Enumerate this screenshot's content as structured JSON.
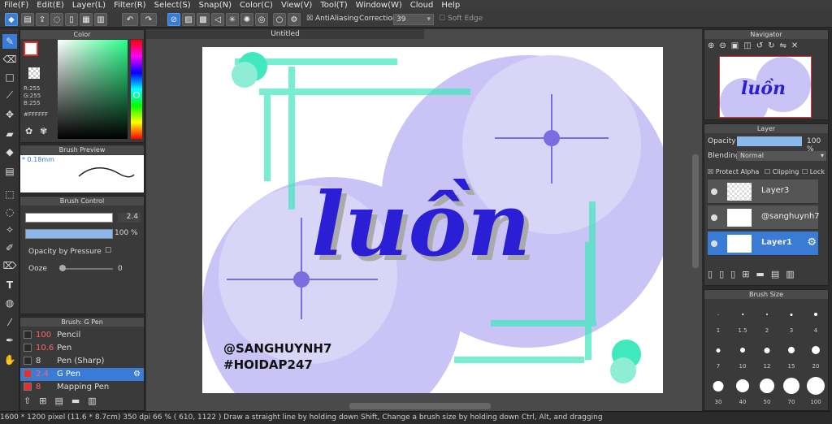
{
  "menu": [
    "File(F)",
    "Edit(E)",
    "Layer(L)",
    "Filter(R)",
    "Select(S)",
    "Snap(N)",
    "Color(C)",
    "View(V)",
    "Tool(T)",
    "Window(W)",
    "Cloud",
    "Help"
  ],
  "toolbar": {
    "antialiasing": "AntiAliasing",
    "correction_label": "Correction",
    "correction_value": "39",
    "soft_edge": "Soft Edge"
  },
  "color_panel": {
    "title": "Color",
    "r": "R:255",
    "g": "G:255",
    "b": "B:255",
    "hex": "#FFFFFF"
  },
  "brush_preview": {
    "title": "Brush Preview",
    "size": "0.18mm"
  },
  "brush_control": {
    "title": "Brush Control",
    "size": "2.4",
    "opacity": "100 %",
    "opacity_by_pressure": "Opacity by Pressure",
    "ooze": "Ooze",
    "ooze_value": "0"
  },
  "brush_list": {
    "title": "Brush: G Pen",
    "items": [
      {
        "size": "100",
        "name": "Pencil",
        "color": "#2a2a2a"
      },
      {
        "size": "10.6",
        "name": "Pen",
        "color": "#2a2a2a"
      },
      {
        "size": "8",
        "name": "Pen (Sharp)",
        "color": "#2a2a2a"
      },
      {
        "size": "2.4",
        "name": "G Pen",
        "color": "#e03030"
      },
      {
        "size": "8",
        "name": "Mapping Pen",
        "color": "#e03030"
      }
    ]
  },
  "canvas": {
    "tab": "Untitled",
    "handle1": "@SANGHUYNH7",
    "handle2": "#HOIDAP247",
    "title_word": "luồn"
  },
  "navigator": {
    "title": "Navigator",
    "thumb_word": "luồn"
  },
  "layer_panel": {
    "title": "Layer",
    "opacity_label": "Opacity",
    "opacity_value": "100 %",
    "blending_label": "Blending",
    "blending_value": "Normal",
    "protect_alpha": "Protect Alpha",
    "clipping": "Clipping",
    "lock": "Lock",
    "layers": [
      "Layer3",
      "@sanghuynh7",
      "Layer1"
    ]
  },
  "brush_size": {
    "title": "Brush Size",
    "sizes": [
      "1",
      "1.5",
      "2",
      "3",
      "4",
      "7",
      "10",
      "12",
      "15",
      "20",
      "30",
      "40",
      "50",
      "70",
      "100"
    ]
  },
  "status": "1600 * 1200 pixel   (11.6 * 8.7cm)   350 dpi   66 %   ( 610, 1122 )   Draw a straight line by holding down Shift, Change a brush size by holding down Ctrl, Alt, and dragging"
}
